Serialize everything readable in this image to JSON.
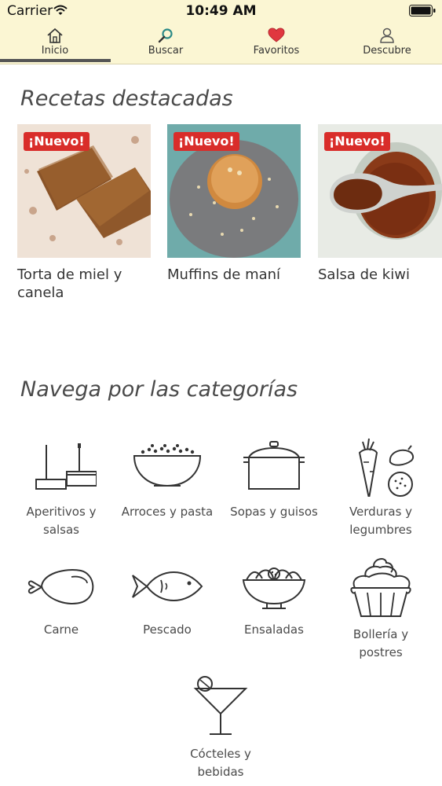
{
  "status_bar": {
    "carrier": "Carrier",
    "time": "10:49 AM"
  },
  "tabs": [
    {
      "label": "Inicio",
      "icon": "home-icon",
      "active": true
    },
    {
      "label": "Buscar",
      "icon": "search-icon",
      "active": false
    },
    {
      "label": "Favoritos",
      "icon": "heart-icon",
      "active": false
    },
    {
      "label": "Descubre",
      "icon": "person-icon",
      "active": false
    }
  ],
  "featured": {
    "title": "Recetas destacadas",
    "recipes": [
      {
        "badge": "¡Nuevo!",
        "title": "Torta de miel y canela",
        "image": "honey-cinnamon-cake-photo"
      },
      {
        "badge": "¡Nuevo!",
        "title": "Muffins de maní",
        "image": "peanut-muffin-photo"
      },
      {
        "badge": "¡Nuevo!",
        "title": "Salsa de kiwi",
        "image": "kiwi-sauce-photo"
      }
    ]
  },
  "categories": {
    "title": "Navega por las categorías",
    "items": [
      {
        "label": "Aperitivos y salsas",
        "icon": "appetizer-icon"
      },
      {
        "label": "Arroces y pasta",
        "icon": "rice-bowl-icon"
      },
      {
        "label": "Sopas y guisos",
        "icon": "pot-icon"
      },
      {
        "label": "Verduras y legumbres",
        "icon": "vegetables-icon"
      },
      {
        "label": "Carne",
        "icon": "meat-icon"
      },
      {
        "label": "Pescado",
        "icon": "fish-icon"
      },
      {
        "label": "Ensaladas",
        "icon": "salad-icon"
      },
      {
        "label": "Bollería y postres",
        "icon": "cupcake-icon"
      },
      {
        "label": "Cócteles y bebidas",
        "icon": "cocktail-icon"
      }
    ]
  },
  "colors": {
    "header_bg": "#fbf6d3",
    "badge_red": "#d92d2a",
    "heart_red": "#e0373f",
    "search_teal": "#2b8a87",
    "active_tab_bar": "#555555"
  }
}
